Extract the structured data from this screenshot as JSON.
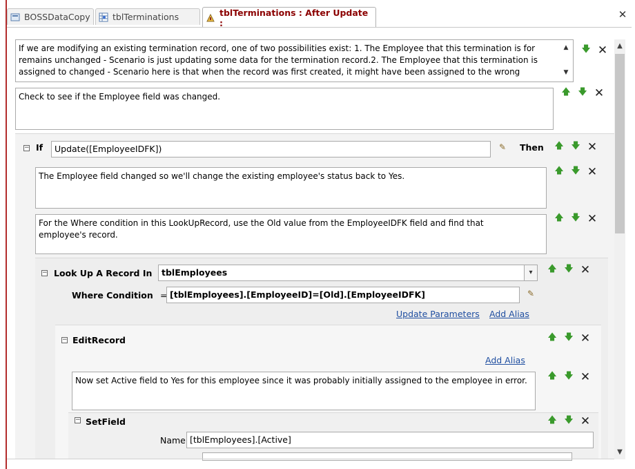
{
  "tabs": [
    {
      "label": "BOSSDataCopy"
    },
    {
      "label": "tblTerminations"
    },
    {
      "label": "tblTerminations : After Update :"
    }
  ],
  "window": {
    "close_glyph": "✕"
  },
  "comment1": {
    "text": "If we are modifying an existing termination record, one of two possibilities exist: 1. The Employee that this termination is for remains unchanged - Scenario is just updating some data for the termination record.2. The Employee that this termination is assigned to changed - Scenario here is that when the record was first created, it might have been assigned to the wrong"
  },
  "comment2": {
    "text": "Check to see if the Employee field was changed."
  },
  "if_block": {
    "keyword": "If",
    "condition": "Update([EmployeeIDFK])",
    "then_label": "Then",
    "comment1": "The Employee field changed so we'll change the existing employee's status back to Yes.",
    "comment2": "For the Where condition in this LookUpRecord, use the Old value from the EmployeeIDFK field and find that employee's record."
  },
  "lookup": {
    "label": "Look Up A Record In",
    "table": "tblEmployees",
    "where_label": "Where Condition",
    "equals": "=",
    "where_value": "[tblEmployees].[EmployeeID]=[Old].[EmployeeIDFK]",
    "update_params": "Update Parameters",
    "add_alias": "Add Alias"
  },
  "editrecord": {
    "label": "EditRecord",
    "add_alias": "Add Alias",
    "comment": "Now set Active field to Yes for this employee since it was probably initially assigned to the employee in error."
  },
  "setfield": {
    "label": "SetField",
    "name_label": "Name",
    "name_value": "[tblEmployees].[Active]",
    "value_value": ""
  },
  "glyphs": {
    "collapse": "⊟",
    "up": "🡅",
    "down": "🡇",
    "delete": "✕",
    "scroll_up": "▲",
    "scroll_down": "▼",
    "dropdown": "▾"
  },
  "colors": {
    "arrow_green": "#3a9a2c",
    "active_tab_text": "#8b0000",
    "link_blue": "#1f4ea0"
  }
}
